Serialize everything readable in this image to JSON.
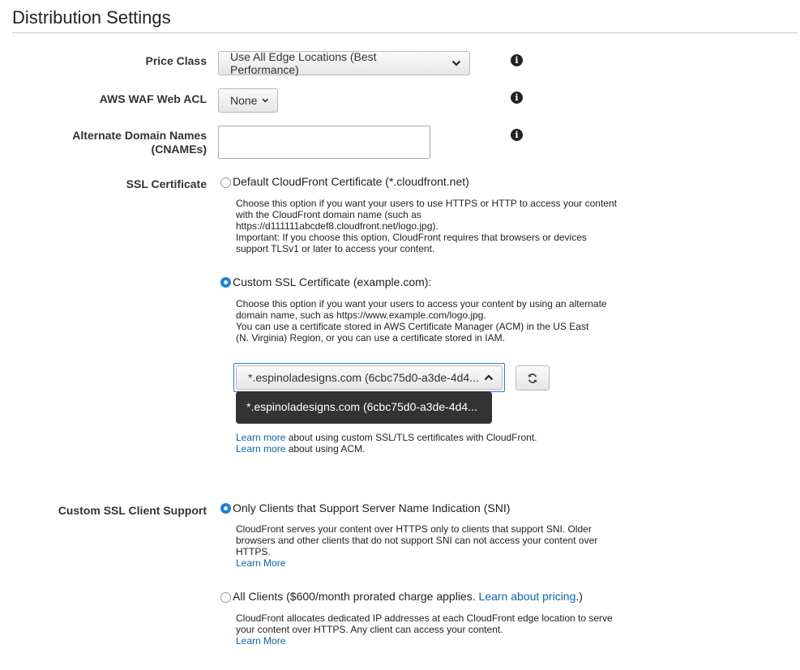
{
  "page": {
    "title": "Distribution Settings"
  },
  "price_class": {
    "label": "Price Class",
    "value": "Use All Edge Locations (Best Performance)"
  },
  "waf": {
    "label": "AWS WAF Web ACL",
    "value": "None"
  },
  "cnames": {
    "label_line1": "Alternate Domain Names",
    "label_line2": "(CNAMEs)",
    "value": ""
  },
  "ssl": {
    "label": "SSL Certificate",
    "default_option": "Default CloudFront Certificate (*.cloudfront.net)",
    "default_desc": [
      "Choose this option if you want your users to use HTTPS or HTTP to access your content",
      "with the CloudFront domain name (such as",
      "https://d111111abcdef8.cloudfront.net/logo.jpg).",
      "Important: If you choose this option, CloudFront requires that browsers or devices",
      "support TLSv1 or later to access your content."
    ],
    "custom_option": "Custom SSL Certificate (example.com):",
    "custom_desc": [
      "Choose this option if you want your users to access your content by using an alternate",
      "domain name, such as https://www.example.com/logo.jpg.",
      "You can use a certificate stored in AWS Certificate Manager (ACM) in the US East",
      "(N. Virginia) Region, or you can use a certificate stored in IAM."
    ],
    "certificate_value": "*.espinoladesigns.com (6cbc75d0-a3de-4d4...",
    "tooltip_text": "*.espinoladesigns.com (6cbc75d0-a3de-4d4...",
    "learn_more_1_link": "Learn more",
    "learn_more_1_text": " about using custom SSL/TLS certificates with CloudFront.",
    "learn_more_2_link": "Learn more",
    "learn_more_2_text": " about using ACM."
  },
  "client_support": {
    "label": "Custom SSL Client Support",
    "sni_option": "Only Clients that Support Server Name Indication (SNI)",
    "sni_desc": [
      "CloudFront serves your content over HTTPS only to clients that support SNI. Older",
      "browsers and other clients that do not support SNI can not access your content over",
      "HTTPS."
    ],
    "sni_learn_more": "Learn More",
    "all_option_prefix": "All Clients ($600/month prorated charge applies. ",
    "all_option_link": "Learn about pricing",
    "all_option_suffix": ".)",
    "all_desc": [
      "CloudFront allocates dedicated IP addresses at each CloudFront edge location to serve",
      "your content over HTTPS. Any client can access your content."
    ],
    "all_learn_more": "Learn More"
  },
  "selected": {
    "ssl_certificate": "custom",
    "client_support": "sni"
  },
  "icons": {
    "info": "info-icon",
    "dropdown": "chevron-down-icon",
    "dropup": "chevron-up-icon",
    "refresh": "refresh-icon"
  },
  "colors": {
    "accent": "#1d7fdf",
    "link": "#0a63b5",
    "tooltip_bg": "#333333"
  }
}
